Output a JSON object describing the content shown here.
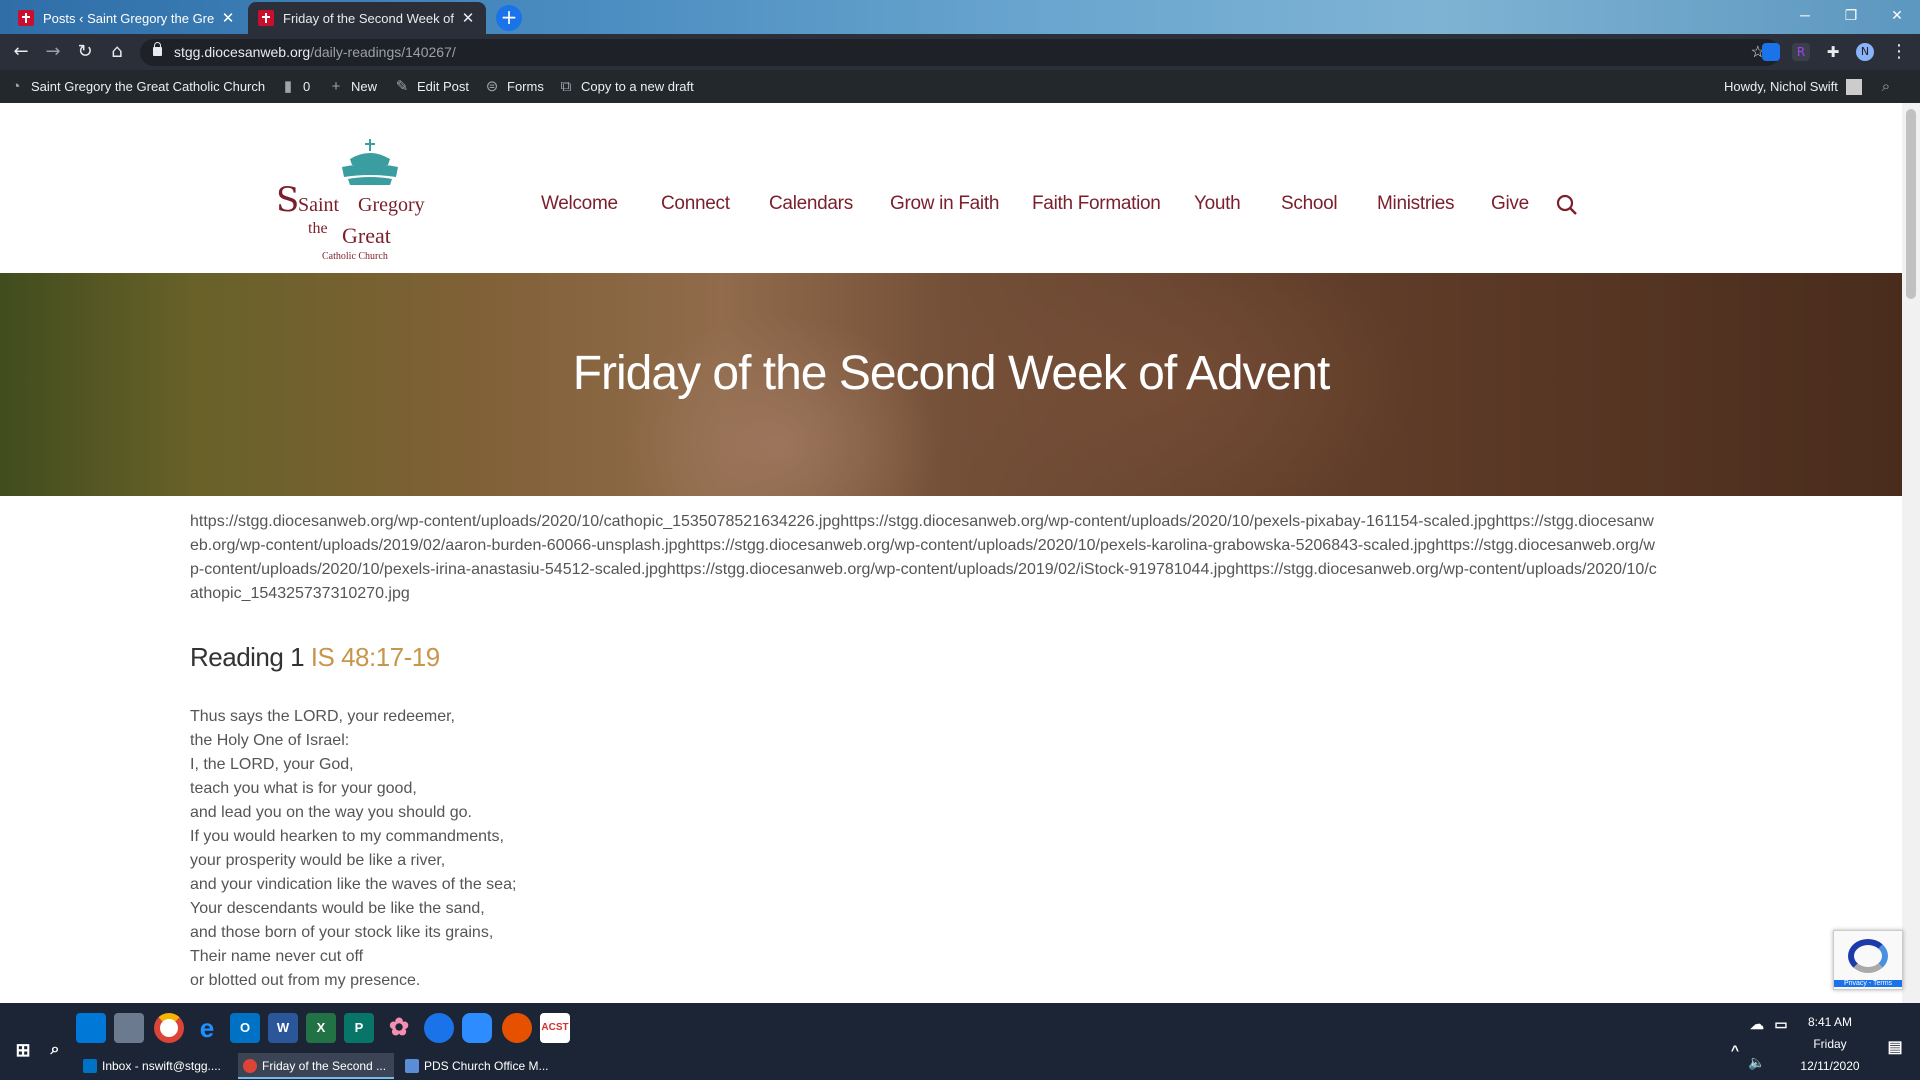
{
  "browser": {
    "tabs": [
      {
        "title": "Posts ‹ Saint Gregory the Great C",
        "active": false
      },
      {
        "title": "Friday of the Second Week of Ad",
        "active": true
      }
    ],
    "url_host": "stgg.diocesanweb.org",
    "url_path": "/daily-readings/140267/"
  },
  "adminbar": {
    "site_name": "Saint Gregory the Great Catholic Church",
    "comments_count": "0",
    "new_label": "New",
    "edit_label": "Edit Post",
    "forms_label": "Forms",
    "copy_label": "Copy to a new draft",
    "howdy": "Howdy, Nichol Swift"
  },
  "logo": {
    "line1a": "Saint",
    "line1b": "Gregory",
    "line2a": "the",
    "line2b": "Great",
    "line3": "Catholic Church"
  },
  "nav": {
    "items": [
      "Welcome",
      "Connect",
      "Calendars",
      "Grow in Faith",
      "Faith Formation",
      "Youth",
      "School",
      "Ministries",
      "Give"
    ]
  },
  "hero": {
    "title": "Friday of the Second Week of Advent"
  },
  "content": {
    "urls": "https://stgg.diocesanweb.org/wp-content/uploads/2020/10/cathopic_1535078521634226.jpghttps://stgg.diocesanweb.org/wp-content/uploads/2020/10/pexels-pixabay-161154-scaled.jpghttps://stgg.diocesanweb.org/wp-content/uploads/2019/02/aaron-burden-60066-unsplash.jpghttps://stgg.diocesanweb.org/wp-content/uploads/2020/10/pexels-karolina-grabowska-5206843-scaled.jpghttps://stgg.diocesanweb.org/wp-content/uploads/2020/10/pexels-irina-anastasiu-54512-scaled.jpghttps://stgg.diocesanweb.org/wp-content/uploads/2019/02/iStock-919781044.jpghttps://stgg.diocesanweb.org/wp-content/uploads/2020/10/cathopic_154325737310270.jpg",
    "reading_label": "Reading 1",
    "reading_ref": "IS 48:17-19",
    "verses": [
      "Thus says the LORD, your redeemer,",
      "the Holy One of Israel:",
      "I, the LORD, your God,",
      "teach you what is for your good,",
      "and lead you on the way you should go.",
      "If you would hearken to my commandments,",
      "your prosperity would be like a river,",
      "and your vindication like the waves of the sea;",
      "Your descendants would be like the sand,",
      "and those born of your stock like its grains,",
      "Their name never cut off",
      "or blotted out from my presence."
    ]
  },
  "recaptcha": {
    "label": "Privacy - Terms"
  },
  "taskbar": {
    "tasks": [
      "Inbox - nswift@stgg....",
      "Friday of the Second ...",
      "PDS Church Office M..."
    ],
    "time": "8:41 AM",
    "day": "Friday",
    "date": "12/11/2020"
  },
  "colors": {
    "nav_text": "#7a1f2b",
    "reading_ref": "#c8964a",
    "adminbar_bg": "#23282d",
    "taskbar_bg": "#1c2536"
  }
}
